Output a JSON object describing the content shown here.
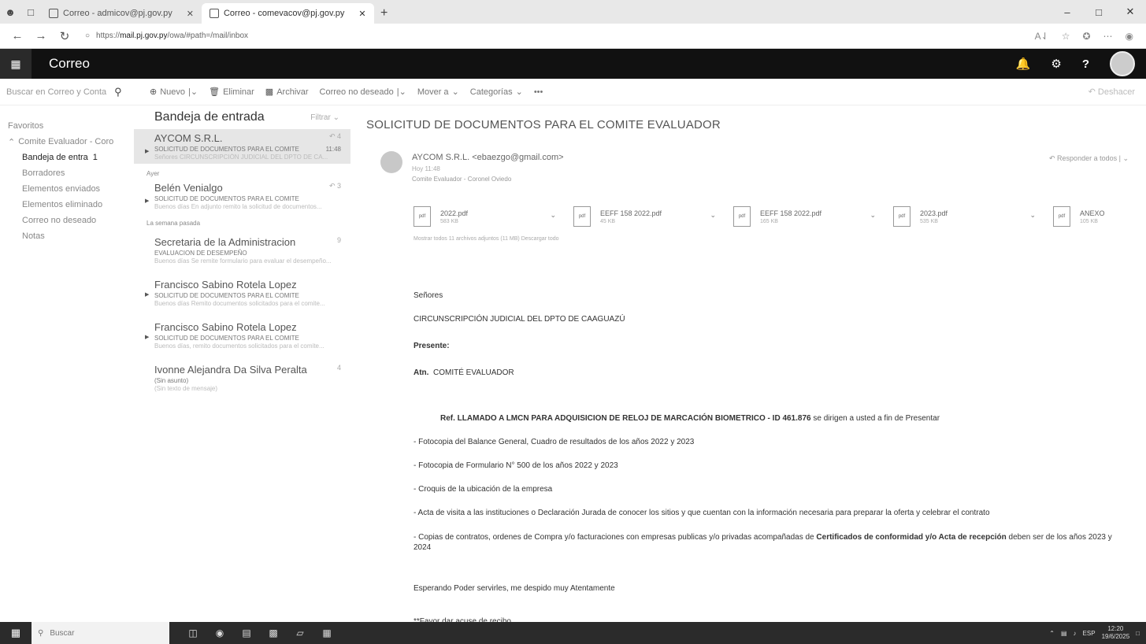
{
  "browser": {
    "tabs": [
      {
        "label": "Correo - admicov@pj.gov.py",
        "active": false
      },
      {
        "label": "Correo - comevacov@pj.gov.py",
        "active": true
      }
    ],
    "url_host": "mail.pj.gov.py",
    "url_prefix": "https://",
    "url_path": "/owa/#path=/mail/inbox"
  },
  "app": {
    "name": "Correo",
    "icons": [
      "bell-icon",
      "gear-icon",
      "help-icon"
    ]
  },
  "commandbar": {
    "search_placeholder": "Buscar en Correo y Conta",
    "new_label": "Nuevo",
    "delete_label": "Eliminar",
    "archive_label": "Archivar",
    "junk_label": "Correo no deseado",
    "move_label": "Mover a",
    "categories_label": "Categorías",
    "more_label": "•••",
    "undo_label": "Deshacer"
  },
  "leftnav": {
    "favorites": "Favoritos",
    "account": "Comite Evaluador - Coro",
    "items": [
      {
        "label": "Bandeja de entra",
        "count": "1",
        "selected": true
      },
      {
        "label": "Borradores",
        "count": "",
        "selected": false
      },
      {
        "label": "Elementos enviados",
        "count": "",
        "selected": false
      },
      {
        "label": "Elementos eliminado",
        "count": "",
        "selected": false
      },
      {
        "label": "Correo no deseado",
        "count": "",
        "selected": false
      },
      {
        "label": "Notas",
        "count": "",
        "selected": false
      }
    ]
  },
  "msglist": {
    "title": "Bandeja de entrada",
    "filter": "Filtrar",
    "groups": {
      "yesterday": "Ayer",
      "lastweek": "La semana pasada"
    },
    "messages": [
      {
        "sender": "AYCOM S.R.L.",
        "meta": "",
        "subject": "SOLICITUD DE DOCUMENTOS PARA EL COMITE",
        "date": "11:48",
        "preview": "Señores CIRCUNSCRIPCIÓN JUDICIAL DEL DPTO DE CA..."
      },
      {
        "sender": "Belén Venialgo",
        "meta": "",
        "subject": "SOLICITUD DE DOCUMENTOS PARA EL COMITE",
        "date": "",
        "preview": "Buenos días En adjunto remito la solicitud de documentos..."
      },
      {
        "sender": "Secretaria de la Administracion",
        "meta": "9",
        "subject": "EVALUACION DE DESEMPEÑO",
        "date": "",
        "preview": "Buenos días Se remite formulario para evaluar el desempeño..."
      },
      {
        "sender": "Francisco Sabino Rotela Lopez",
        "meta": "",
        "subject": "SOLICITUD DE DOCUMENTOS PARA EL COMITE",
        "date": "",
        "preview": "Buenos días Remito documentos solicitados para el comite..."
      },
      {
        "sender": "Francisco Sabino Rotela Lopez",
        "meta": "",
        "subject": "SOLICITUD DE DOCUMENTOS PARA EL COMITE",
        "date": "",
        "preview": "Buenos días, remito documentos solicitados para el comite..."
      },
      {
        "sender": "Ivonne Alejandra Da Silva Peralta",
        "meta": "4",
        "subject": "(Sin asunto)",
        "date": "",
        "preview": "(Sin texto de mensaje)"
      }
    ]
  },
  "reading": {
    "subject": "SOLICITUD DE DOCUMENTOS PARA EL COMITE EVALUADOR",
    "from": "AYCOM S.R.L. <ebaezgo@gmail.com>",
    "date": "Hoy 11:48",
    "to": "Comite Evaluador - Coronel Oviedo",
    "reply_all": "Responder a todos",
    "attachments": [
      {
        "name": "2022.pdf",
        "size": "583 KB"
      },
      {
        "name": "EEFF 158 2022.pdf",
        "size": "45 KB"
      },
      {
        "name": "EEFF 158 2022.pdf",
        "size": "165 KB"
      },
      {
        "name": "2023.pdf",
        "size": "535 KB"
      },
      {
        "name": "ANEXO",
        "size": "105 KB"
      }
    ],
    "show_all": "Mostrar todos 11 archivos adjuntos (11 MB)   Descargar todo",
    "body": {
      "l1": "Señores",
      "l2": "CIRCUNSCRIPCIÓN  JUDICIAL DEL DPTO DE CAAGUAZÚ",
      "l3": "Presente:",
      "l4a": "Atn.",
      "l4b": "COMITÉ EVALUADOR",
      "ref_bold": "Ref. LLAMADO A LMCN PARA ADQUISICION DE RELOJ DE MARCACIÓN BIOMETRICO - ID 461.876",
      "ref_rest": "  se dirigen a usted a fin de Presentar",
      "i1": "- Fotocopia del Balance General, Cuadro de resultados de los años 2022 y 2023",
      "i2": "-  Fotocopia de Formulario N° 500 de los años 2022 y 2023",
      "i3": "-  Croquis de la ubicación de la empresa",
      "i4": "- Acta de visita a las instituciones o Declaración Jurada de conocer los sitios y que cuentan con la información necesaria para preparar la oferta y celebrar el contrato",
      "i5a": "- Copias de contratos, ordenes de Compra y/o facturaciones con empresas publicas y/o privadas acompañadas de ",
      "i5b": "Certificados de conformidad y/o Acta de recepción",
      "i5c": " deben ser de los años 2023 y 2024",
      "closing": "Esperando Poder servirles, me despido muy Atentamente",
      "ps": "**Favor dar acuse de recibo"
    }
  },
  "taskbar": {
    "search": "Buscar",
    "lang": "ESP",
    "time": "12:20",
    "date": "19/6/2025"
  }
}
